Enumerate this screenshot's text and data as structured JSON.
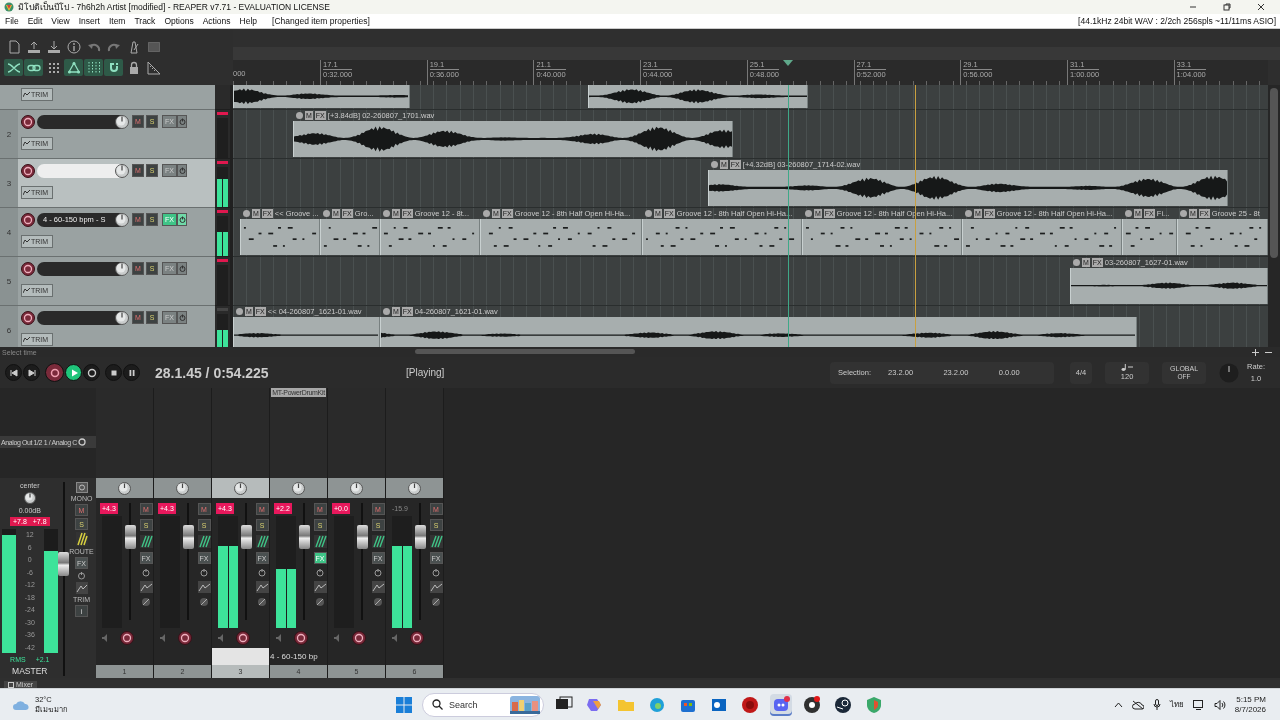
{
  "window": {
    "title": "มิโปดิเป็นปีโป - 7h6h2h Artist [modified] - REAPER v7.71 - EVALUATION LICENSE"
  },
  "menu": {
    "items": [
      "File",
      "Edit",
      "View",
      "Insert",
      "Item",
      "Track",
      "Options",
      "Actions",
      "Help"
    ],
    "status": "[Changed item properties]",
    "audio_info": "[44.1kHz 24bit WAV : 2/2ch 256spls ~11/11ms ASIO]"
  },
  "toolbar": {
    "rows": [
      [
        {
          "kind": "new",
          "on": false
        },
        {
          "kind": "upload",
          "on": false
        },
        {
          "kind": "download",
          "on": false
        },
        {
          "kind": "info",
          "on": false
        },
        {
          "kind": "undo",
          "on": false
        },
        {
          "kind": "redo",
          "on": false
        },
        {
          "kind": "metronome",
          "on": false
        },
        {
          "kind": "dotted-square",
          "on": false
        }
      ],
      [
        {
          "kind": "crossfade",
          "on": true
        },
        {
          "kind": "link",
          "on": true
        },
        {
          "kind": "dot-grid",
          "on": false
        },
        {
          "kind": "group",
          "on": true
        },
        {
          "kind": "snap-grid",
          "on": true
        },
        {
          "kind": "magnet",
          "on": true
        },
        {
          "kind": "lock",
          "on": false
        },
        {
          "kind": "ruler",
          "on": false
        }
      ]
    ]
  },
  "ruler": {
    "start_label": "000",
    "marks": [
      {
        "bar": "17.1",
        "time": "0:32.000"
      },
      {
        "bar": "19.1",
        "time": "0:36.000"
      },
      {
        "bar": "21.1",
        "time": "0:40.000"
      },
      {
        "bar": "23.1",
        "time": "0:44.000"
      },
      {
        "bar": "25.1",
        "time": "0:48.000"
      },
      {
        "bar": "27.1",
        "time": "0:52.000"
      },
      {
        "bar": "29.1",
        "time": "0:56.000"
      },
      {
        "bar": "31.1",
        "time": "1:00.000"
      },
      {
        "bar": "33.1",
        "time": "1:04.000"
      }
    ]
  },
  "tracks": [
    {
      "kind": "cut",
      "trim": "TRIM",
      "items": [
        {
          "kind": "audio"
        },
        {
          "kind": "audio"
        }
      ]
    },
    {
      "kind": "full",
      "number": "2",
      "selected": false,
      "fx_active": false,
      "clip": true,
      "level": 0,
      "mute": "M",
      "solo": "S",
      "fx": "FX",
      "trim": "TRIM",
      "items": [
        {
          "kind": "audio",
          "badges": [
            "M",
            "FX"
          ],
          "label": "[+3.84dB] 02-260807_1701.wav"
        }
      ]
    },
    {
      "kind": "full",
      "number": "3",
      "selected": true,
      "fx_active": false,
      "clip": true,
      "level": 0.7,
      "mute": "M",
      "solo": "S",
      "fx": "FX",
      "trim": "TRIM",
      "items": [
        {
          "kind": "audio",
          "badges": [
            "M",
            "FX"
          ],
          "label": "[+4.32dB] 03-260807_1714-02.wav"
        }
      ]
    },
    {
      "kind": "full",
      "number": "4",
      "name": "4 - 60-150 bpm - S",
      "selected": false,
      "fx_active": true,
      "clip": true,
      "level": 0.6,
      "mute": "M",
      "solo": "S",
      "fx": "FX",
      "trim": "TRIM",
      "items": [
        {
          "kind": "midi",
          "badges": [
            "M",
            "FX"
          ],
          "label": "<< Groove ..."
        },
        {
          "kind": "midi",
          "badges": [
            "M",
            "FX"
          ],
          "label": "Gro..."
        },
        {
          "kind": "midi",
          "badges": [
            "M",
            "FX"
          ],
          "label": "Groove 12 - 8t..."
        },
        {
          "kind": "midi",
          "badges": [
            "M",
            "FX"
          ],
          "label": "Groove 12 - 8th Half Open Hi-Ha..."
        },
        {
          "kind": "midi",
          "badges": [
            "M",
            "FX"
          ],
          "label": "Groove 12 - 8th Half Open Hi-Ha..."
        },
        {
          "kind": "midi",
          "badges": [
            "M",
            "FX"
          ],
          "label": "Groove 12 - 8th Half Open Hi-Ha..."
        },
        {
          "kind": "midi",
          "badges": [
            "M",
            "FX"
          ],
          "label": "Groove 12 - 8th Half Open Hi-Ha..."
        },
        {
          "kind": "midi",
          "badges": [
            "M",
            "FX"
          ],
          "label": "Fi..."
        },
        {
          "kind": "midi",
          "badges": [
            "M",
            "FX"
          ],
          "label": "Groove 25 - 8t"
        }
      ]
    },
    {
      "kind": "full",
      "number": "5",
      "selected": false,
      "fx_active": false,
      "clip": true,
      "level": 0,
      "mute": "M",
      "solo": "S",
      "fx": "FX",
      "trim": "TRIM",
      "items": [
        {
          "kind": "audio",
          "badges": [
            "M",
            "FX"
          ],
          "label": "03-260807_1627-01.wav"
        }
      ]
    },
    {
      "kind": "full",
      "number": "6",
      "selected": false,
      "fx_active": false,
      "clip": false,
      "level": 0.6,
      "mute": "M",
      "solo": "S",
      "fx": "FX",
      "trim": "TRIM",
      "items": [
        {
          "kind": "audio",
          "badges": [
            "M",
            "FX"
          ],
          "label": "<< 04-260807_1621-01.wav"
        },
        {
          "kind": "audio",
          "badges": [
            "M",
            "FX"
          ],
          "label": "04-260807_1621-01.wav"
        }
      ]
    }
  ],
  "transport": {
    "status": "Select time",
    "buttons": [
      {
        "kind": "start",
        "on": false
      },
      {
        "kind": "end",
        "on": false
      },
      {
        "kind": "record",
        "on": false
      },
      {
        "kind": "play",
        "on": true
      },
      {
        "kind": "repeat",
        "on": false
      },
      {
        "kind": "stop",
        "on": false
      },
      {
        "kind": "pause",
        "on": false
      }
    ],
    "position": "28.1.45 / 0:54.225",
    "state": "[Playing]",
    "selection_label": "Selection:",
    "selection": [
      "23.2.00",
      "23.2.00",
      "0.0.00"
    ],
    "time_signature": "4/4",
    "tempo": "120",
    "playrate_label": "GLOBAL",
    "playrate_mode": "OFF",
    "rate_label": "Rate:",
    "rate": "1.0"
  },
  "mixer": {
    "master": {
      "output": "Analog Out 1/2 1 / Analog C",
      "pan": "center",
      "volume": "0.00dB",
      "peaks": [
        "+7.8",
        "+7.8"
      ],
      "scale": [
        "12",
        "6",
        "0",
        "-6",
        "-12",
        "-18",
        "-24",
        "-30",
        "-36",
        "-42"
      ],
      "meters": [
        {
          "level": 0.95
        },
        {
          "level": 0.82
        }
      ],
      "mono": "MONO",
      "mute": "M",
      "solo": "S",
      "route": "ROUTE",
      "fx": "FX",
      "trim": "TRIM",
      "info": "i",
      "rms": "RMS",
      "rms_value": "+2.1",
      "name": "MASTER"
    },
    "channels": [
      {
        "number": "1",
        "peak": "+4.3",
        "clip": true,
        "selected": false,
        "fx_active": false,
        "level": 0,
        "mute": "M",
        "solo": "S",
        "fx": "FX"
      },
      {
        "number": "2",
        "peak": "+4.3",
        "clip": true,
        "selected": false,
        "fx_active": false,
        "level": 0,
        "mute": "M",
        "solo": "S",
        "fx": "FX"
      },
      {
        "number": "3",
        "peak": "+4.3",
        "clip": true,
        "selected": true,
        "fx_active": false,
        "level": 0.73,
        "mute": "M",
        "solo": "S",
        "fx": "FX"
      },
      {
        "number": "4",
        "peak": "+2.2",
        "clip": true,
        "selected": false,
        "fx_active": true,
        "level": 0.53,
        "mute": "M",
        "solo": "S",
        "fx": "FX",
        "plugin": "MT-PowerDrumKit",
        "name": "4 - 60-150 bp"
      },
      {
        "number": "5",
        "peak": "+0.0",
        "clip": true,
        "selected": false,
        "fx_active": false,
        "level": 0,
        "mute": "M",
        "solo": "S",
        "fx": "FX"
      },
      {
        "number": "6",
        "peak": "-15.9",
        "clip": false,
        "selected": false,
        "fx_active": false,
        "level": 0.73,
        "mute": "M",
        "solo": "S",
        "fx": "FX"
      }
    ],
    "tab": "Mixer"
  },
  "taskbar": {
    "weather": {
      "temperature": "32°C",
      "condition": "มีเมฆมาก"
    },
    "search": {
      "placeholder": "Search"
    },
    "apps": [
      {
        "kind": "task-view",
        "selected": false
      },
      {
        "kind": "copilot",
        "selected": false
      },
      {
        "kind": "folder",
        "selected": false
      },
      {
        "kind": "edge",
        "selected": false
      },
      {
        "kind": "store",
        "selected": false
      },
      {
        "kind": "mail",
        "selected": false
      },
      {
        "kind": "record",
        "selected": false
      },
      {
        "kind": "chat",
        "selected": true
      },
      {
        "kind": "camera",
        "selected": false
      },
      {
        "kind": "steam",
        "selected": false
      },
      {
        "kind": "shield",
        "selected": false
      }
    ],
    "tray": {
      "language": "ไทย",
      "time": "5:15 PM",
      "date": "8/7/2026"
    }
  }
}
